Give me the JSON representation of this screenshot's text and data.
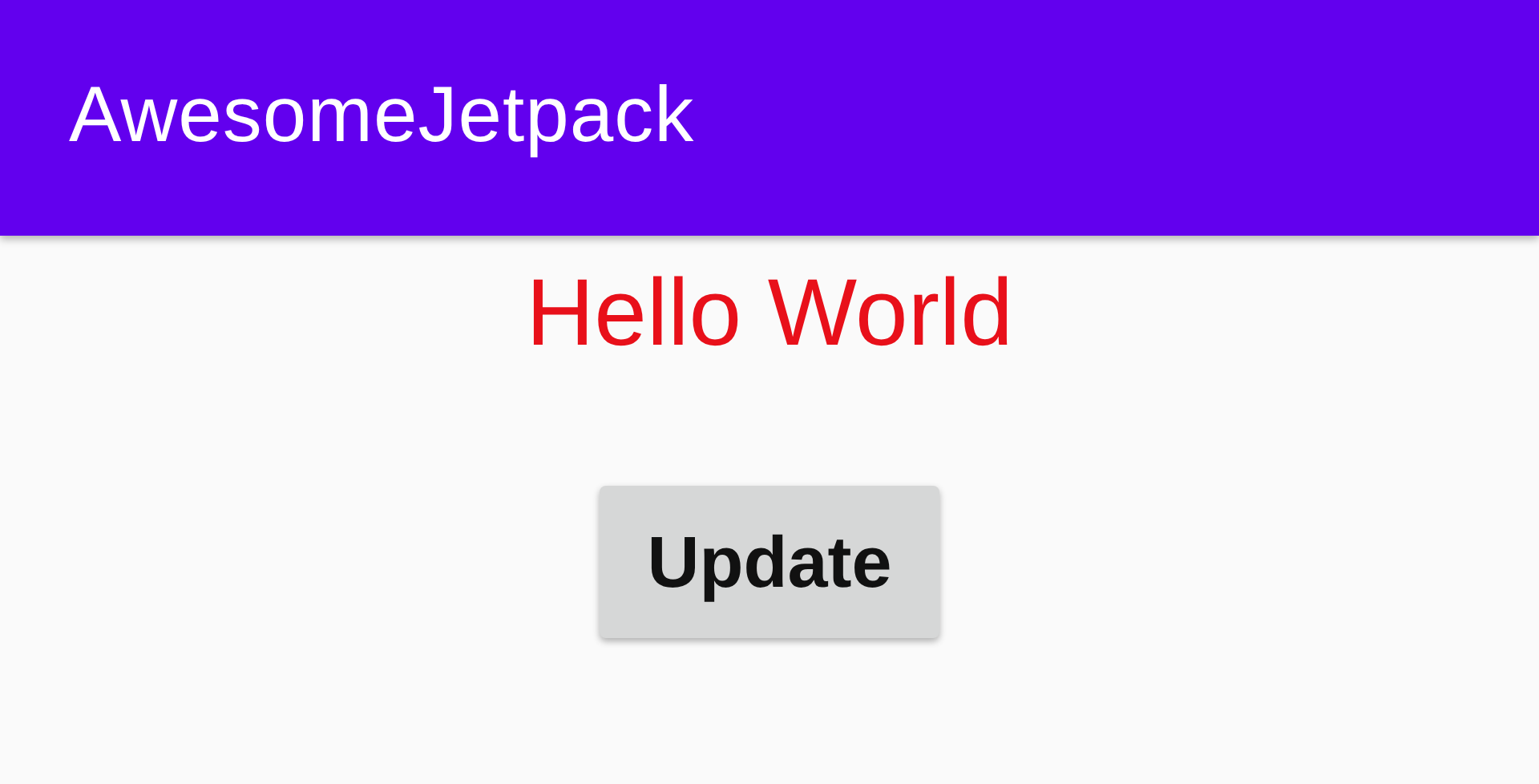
{
  "app_bar": {
    "title": "AwesomeJetpack"
  },
  "greeting": {
    "text": "Hello World"
  },
  "button": {
    "label": "Update"
  }
}
